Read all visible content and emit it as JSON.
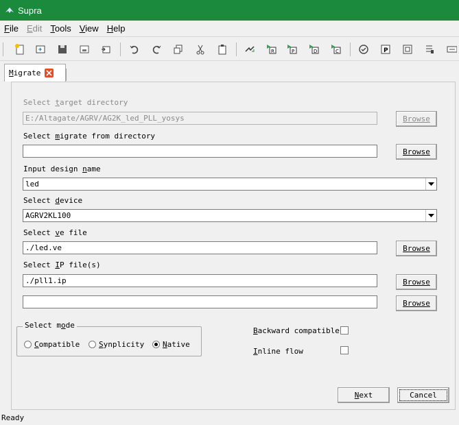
{
  "window": {
    "title": "Supra"
  },
  "menubar": {
    "items": [
      {
        "label": "File",
        "accel": "F",
        "rest": "ile",
        "enabled": true
      },
      {
        "label": "Edit",
        "accel": "E",
        "rest": "dit",
        "enabled": false
      },
      {
        "label": "Tools",
        "accel": "T",
        "rest": "ools",
        "enabled": true
      },
      {
        "label": "View",
        "accel": "V",
        "rest": "iew",
        "enabled": true
      },
      {
        "label": "Help",
        "accel": "H",
        "rest": "elp",
        "enabled": true
      }
    ]
  },
  "toolbar": {
    "icons": [
      "new-file-icon",
      "open-icon",
      "save-icon",
      "save-as-icon",
      "save-all-icon",
      "undo-icon",
      "redo-icon",
      "copy-icon",
      "cut-icon",
      "paste-icon",
      "migrate-icon",
      "run-r-icon",
      "run-p-icon",
      "run-d-icon",
      "run-c-icon",
      "check-icon",
      "p-box-icon",
      "d-box-icon",
      "settings-icon",
      "more-icon"
    ]
  },
  "tab": {
    "label_accel": "M",
    "label_rest": "igrate"
  },
  "form": {
    "target_dir": {
      "label_pre": "Select ",
      "label_accel": "t",
      "label_post": "arget directory",
      "value": "E:/Altagate/AGRV/AG2K_led_PLL_yosys",
      "browse": "Browse"
    },
    "migrate_dir": {
      "label_pre": "Select ",
      "label_accel": "m",
      "label_post": "igrate from directory",
      "value": "",
      "browse": "Browse"
    },
    "design_name": {
      "label_pre": "Input design ",
      "label_accel": "n",
      "label_post": "ame",
      "value": "led"
    },
    "device": {
      "label_pre": "Select ",
      "label_accel": "d",
      "label_post": "evice",
      "value": "AGRV2KL100"
    },
    "ve_file": {
      "label_pre": "Select ",
      "label_accel": "v",
      "label_post": "e file",
      "value": "./led.ve",
      "browse": "Browse"
    },
    "ip_files": {
      "label_pre": "Select ",
      "label_accel": "I",
      "label_post": "P file(s)",
      "value": "./pll1.ip",
      "browse": "Browse"
    },
    "extra_file": {
      "value": "",
      "browse": "Browse"
    },
    "mode": {
      "legend_pre": "Select m",
      "legend_accel": "o",
      "legend_post": "de",
      "options": [
        {
          "accel": "C",
          "rest": "ompatible",
          "checked": false
        },
        {
          "accel": "S",
          "rest": "ynplicity",
          "checked": false
        },
        {
          "accel": "N",
          "rest": "ative",
          "checked": true
        }
      ]
    },
    "backward": {
      "accel": "B",
      "rest": "ackward compatible",
      "checked": false
    },
    "inline": {
      "accel": "I",
      "rest": "nline flow",
      "checked": false
    },
    "next": {
      "accel": "N",
      "rest": "ext"
    },
    "cancel": {
      "label": "Cancel"
    }
  },
  "status": {
    "text": "Ready"
  }
}
